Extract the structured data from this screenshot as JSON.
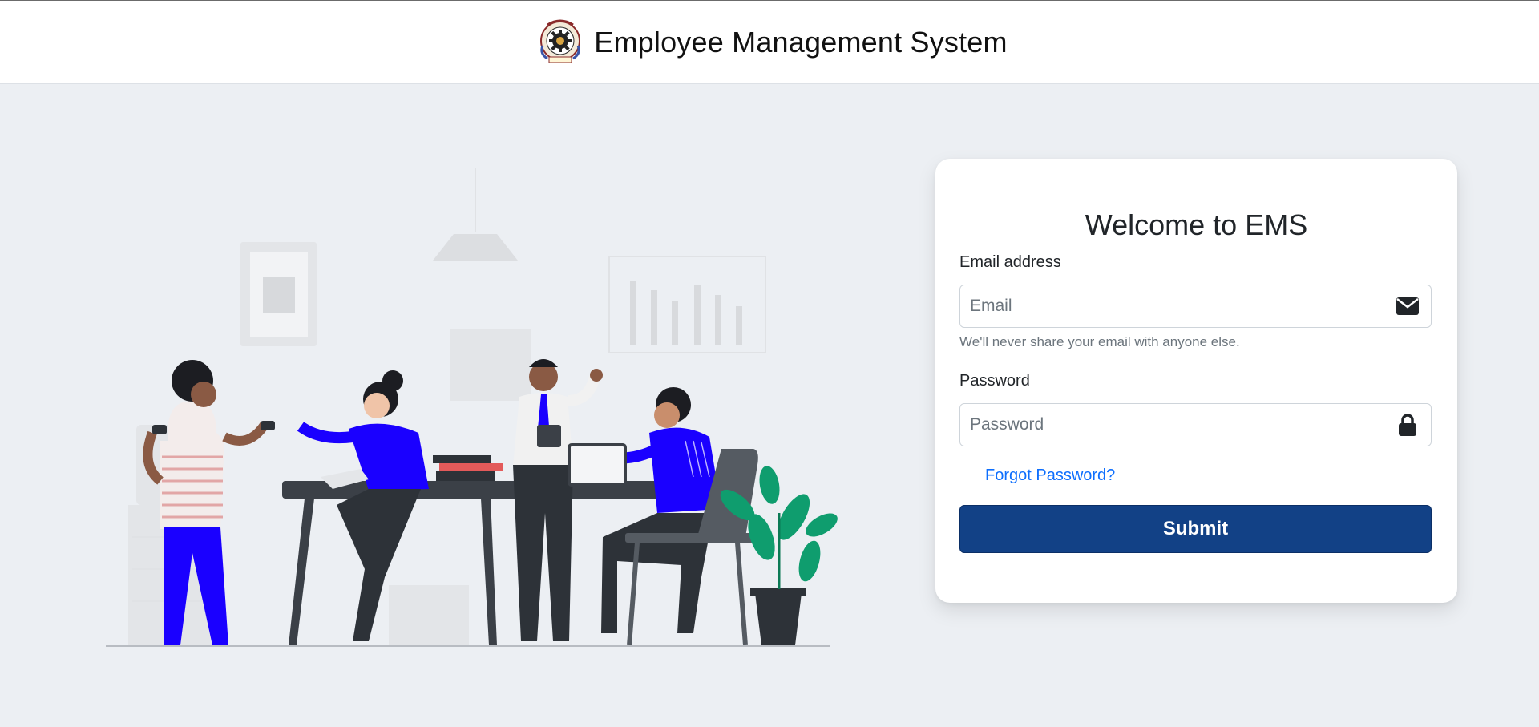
{
  "header": {
    "title": "Employee Management System",
    "logo_icon": "institution-seal-icon"
  },
  "login": {
    "title": "Welcome to EMS",
    "email_label": "Email address",
    "email_placeholder": "Email",
    "email_value": "",
    "email_icon": "envelope-icon",
    "email_help": "We'll never share your email with anyone else.",
    "password_label": "Password",
    "password_placeholder": "Password",
    "password_value": "",
    "password_icon": "lock-icon",
    "forgot_link": "Forgot Password?",
    "submit_label": "Submit"
  },
  "colors": {
    "page_background": "#eceff3",
    "primary_button": "#124186",
    "link": "#0d6efd",
    "illustration_accent": "#1a00ff",
    "plant_green": "#0f9d6e"
  }
}
